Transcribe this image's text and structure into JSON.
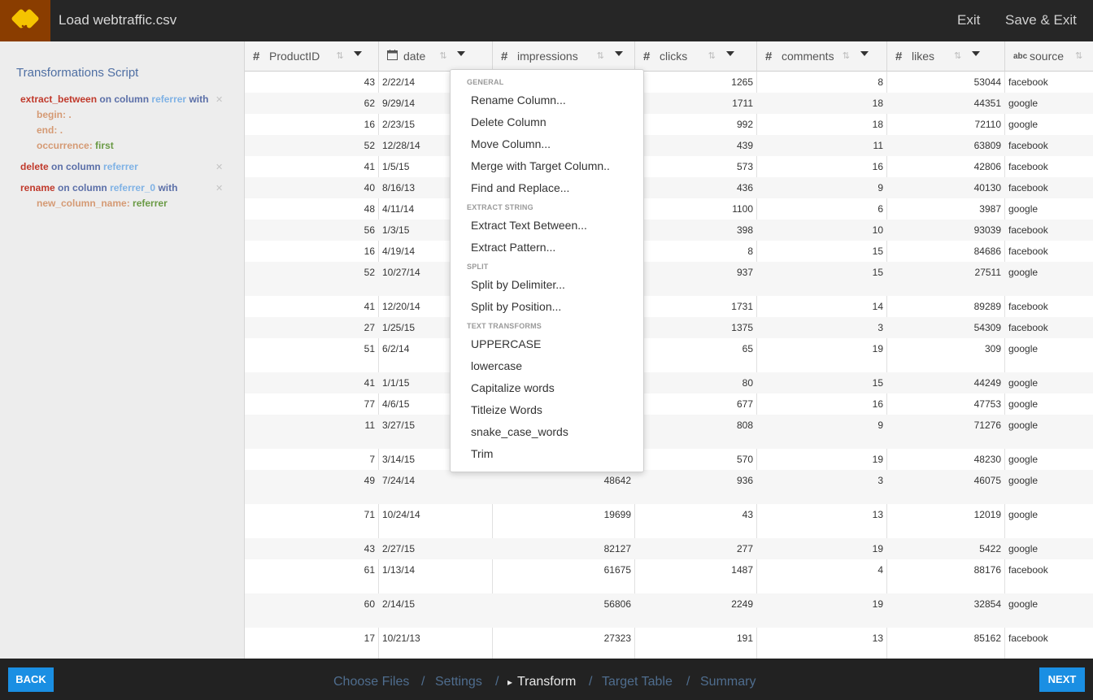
{
  "topbar": {
    "title": "Load webtraffic.csv",
    "exit_label": "Exit",
    "save_exit_label": "Save & Exit"
  },
  "sidebar": {
    "title": "Transformations Script",
    "steps": [
      {
        "fn": "extract_between",
        "on": "on column",
        "col": "referrer",
        "with": "with",
        "params": [
          {
            "k": "begin:",
            "v": "."
          },
          {
            "k": "end:",
            "v": "."
          },
          {
            "k": "occurrence:",
            "v": "first"
          }
        ]
      },
      {
        "fn": "delete",
        "on": "on column",
        "col": "referrer",
        "with": "",
        "params": []
      },
      {
        "fn": "rename",
        "on": "on column",
        "col": "referrer_0",
        "with": "with",
        "params": [
          {
            "k": "new_column_name:",
            "v": "referrer"
          }
        ]
      }
    ]
  },
  "grid": {
    "columns": [
      {
        "type_icon": "#",
        "name": "ProductID"
      },
      {
        "type_icon": "calendar-icon",
        "name": "date"
      },
      {
        "type_icon": "#",
        "name": "impressions"
      },
      {
        "type_icon": "#",
        "name": "clicks"
      },
      {
        "type_icon": "#",
        "name": "comments"
      },
      {
        "type_icon": "#",
        "name": "likes"
      },
      {
        "type_icon": "abc",
        "name": "source"
      }
    ],
    "rows": [
      [
        "43",
        "2/22/14",
        "",
        "1265",
        "8",
        "53044",
        "facebook"
      ],
      [
        "62",
        "9/29/14",
        "",
        "1711",
        "18",
        "44351",
        "google"
      ],
      [
        "16",
        "2/23/15",
        "",
        "992",
        "18",
        "72110",
        "google"
      ],
      [
        "52",
        "12/28/14",
        "",
        "439",
        "11",
        "63809",
        "facebook"
      ],
      [
        "41",
        "1/5/15",
        "",
        "573",
        "16",
        "42806",
        "facebook"
      ],
      [
        "40",
        "8/16/13",
        "",
        "436",
        "9",
        "40130",
        "facebook"
      ],
      [
        "48",
        "4/11/14",
        "",
        "1100",
        "6",
        "3987",
        "google"
      ],
      [
        "56",
        "1/3/15",
        "",
        "398",
        "10",
        "93039",
        "facebook"
      ],
      [
        "16",
        "4/19/14",
        "",
        "8",
        "15",
        "84686",
        "facebook"
      ],
      [
        "52",
        "10/27/14",
        "",
        "937",
        "15",
        "27511",
        "google"
      ],
      [
        "41",
        "12/20/14",
        "",
        "1731",
        "14",
        "89289",
        "facebook"
      ],
      [
        "27",
        "1/25/15",
        "",
        "1375",
        "3",
        "54309",
        "facebook"
      ],
      [
        "51",
        "6/2/14",
        "",
        "65",
        "19",
        "309",
        "google"
      ],
      [
        "41",
        "1/1/15",
        "",
        "80",
        "15",
        "44249",
        "google"
      ],
      [
        "77",
        "4/6/15",
        "",
        "677",
        "16",
        "47753",
        "google"
      ],
      [
        "11",
        "3/27/15",
        "",
        "808",
        "9",
        "71276",
        "google"
      ],
      [
        "7",
        "3/14/15",
        "",
        "570",
        "19",
        "48230",
        "google"
      ],
      [
        "49",
        "7/24/14",
        "48642",
        "936",
        "3",
        "46075",
        "google"
      ],
      [
        "71",
        "10/24/14",
        "19699",
        "43",
        "13",
        "12019",
        "google"
      ],
      [
        "43",
        "2/27/15",
        "82127",
        "277",
        "19",
        "5422",
        "google"
      ],
      [
        "61",
        "1/13/14",
        "61675",
        "1487",
        "4",
        "88176",
        "facebook"
      ],
      [
        "60",
        "2/14/15",
        "56806",
        "2249",
        "19",
        "32854",
        "google"
      ],
      [
        "17",
        "10/21/13",
        "27323",
        "191",
        "13",
        "85162",
        "facebook"
      ]
    ]
  },
  "menu": {
    "sections": [
      {
        "title": "GENERAL",
        "items": [
          "Rename Column...",
          "Delete Column",
          "Move Column...",
          "Merge with Target Column..",
          "Find and Replace..."
        ]
      },
      {
        "title": "EXTRACT STRING",
        "items": [
          "Extract Text Between...",
          "Extract Pattern..."
        ]
      },
      {
        "title": "SPLIT",
        "items": [
          "Split by Delimiter...",
          "Split by Position..."
        ]
      },
      {
        "title": "TEXT TRANSFORMS",
        "items": [
          "UPPERCASE",
          "lowercase",
          "Capitalize words",
          "Titleize Words",
          "snake_case_words",
          "Trim"
        ]
      }
    ]
  },
  "bottombar": {
    "back_label": "BACK",
    "next_label": "NEXT",
    "crumbs": [
      "Choose Files",
      "Settings",
      "Transform",
      "Target Table",
      "Summary"
    ],
    "separator": "/",
    "active_marker": "▸"
  },
  "colors": {
    "accent": "#1a8fe3",
    "topbar": "#262626",
    "logo_bg": "#8a3d00",
    "logo_fg": "#f5c400"
  }
}
